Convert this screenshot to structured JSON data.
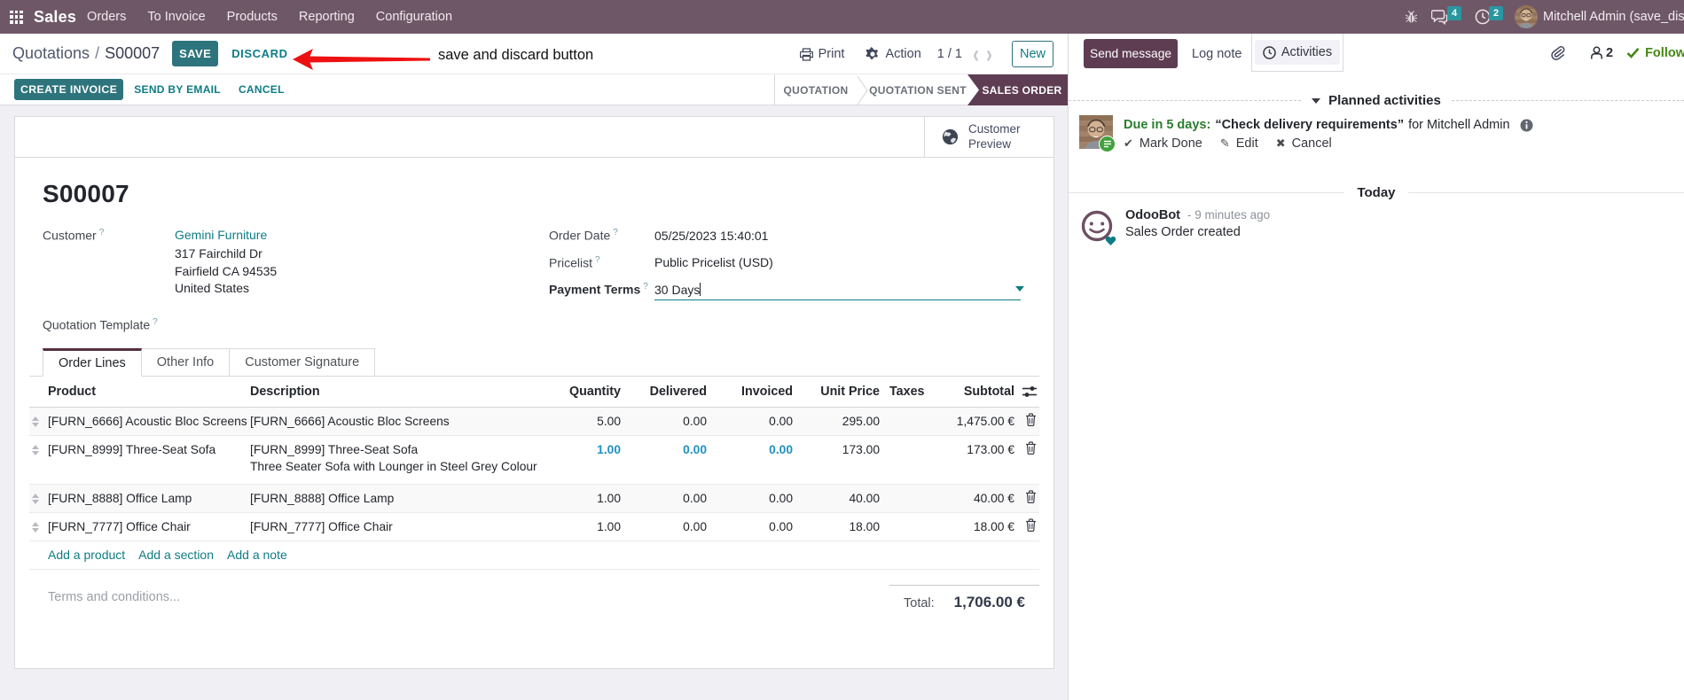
{
  "navbar": {
    "app_name": "Sales",
    "menus": [
      "Orders",
      "To Invoice",
      "Products",
      "Reporting",
      "Configuration"
    ],
    "message_badge": "4",
    "activity_badge": "2",
    "user_name": "Mitchell Admin (save_discard",
    "navbar_color": "#6e5767",
    "badge_color": "#2a97a0"
  },
  "control_panel": {
    "breadcrumb_parent": "Quotations",
    "breadcrumb_sep": "/",
    "breadcrumb_current": "S00007",
    "save_label": "SAVE",
    "discard_label": "DISCARD",
    "annotation_text": "save and discard button",
    "print_label": "Print",
    "action_label": "Action",
    "pager": "1 / 1",
    "prev": "‹",
    "next": "›",
    "new_label": "New"
  },
  "actions": {
    "create_invoice": "CREATE INVOICE",
    "send_by_email": "SEND BY EMAIL",
    "cancel": "CANCEL"
  },
  "statusbar": {
    "stage1": "QUOTATION",
    "stage2": "QUOTATION SENT",
    "stage3": "SALES ORDER",
    "active": "SALES ORDER",
    "active_color": "#5e3d53"
  },
  "sheet": {
    "customer_preview_line1": "Customer",
    "customer_preview_line2": "Preview",
    "title": "S00007",
    "help_mark": "?",
    "fields": {
      "customer_label": "Customer",
      "customer_value": "Gemini Furniture",
      "address_line1": "317 Fairchild Dr",
      "address_line2": "Fairfield CA 94535",
      "address_line3": "United States",
      "quotation_template_label": "Quotation Template",
      "order_date_label": "Order Date",
      "order_date_value": "05/25/2023 15:40:01",
      "pricelist_label": "Pricelist",
      "pricelist_value": "Public Pricelist (USD)",
      "payment_terms_label": "Payment Terms",
      "payment_terms_value": "30 Days"
    },
    "tabs": {
      "tab1": "Order Lines",
      "tab2": "Other Info",
      "tab3": "Customer Signature"
    },
    "table": {
      "headers": {
        "product": "Product",
        "description": "Description",
        "quantity": "Quantity",
        "delivered": "Delivered",
        "invoiced": "Invoiced",
        "unit_price": "Unit Price",
        "taxes": "Taxes",
        "subtotal": "Subtotal"
      },
      "rows": [
        {
          "product": "[FURN_6666] Acoustic Bloc Screens",
          "description": "[FURN_6666] Acoustic Bloc Screens",
          "quantity": "5.00",
          "delivered": "0.00",
          "invoiced": "0.00",
          "unit_price": "295.00",
          "taxes": "",
          "subtotal": "1,475.00 €"
        },
        {
          "product": "[FURN_8999] Three-Seat Sofa",
          "description": "[FURN_8999] Three-Seat Sofa",
          "description2": "Three Seater Sofa with Lounger in Steel Grey Colour",
          "quantity": "1.00",
          "delivered": "0.00",
          "invoiced": "0.00",
          "unit_price": "173.00",
          "taxes": "",
          "subtotal": "173.00 €"
        },
        {
          "product": "[FURN_8888] Office Lamp",
          "description": "[FURN_8888] Office Lamp",
          "quantity": "1.00",
          "delivered": "0.00",
          "invoiced": "0.00",
          "unit_price": "40.00",
          "taxes": "",
          "subtotal": "40.00 €"
        },
        {
          "product": "[FURN_7777] Office Chair",
          "description": "[FURN_7777] Office Chair",
          "quantity": "1.00",
          "delivered": "0.00",
          "invoiced": "0.00",
          "unit_price": "18.00",
          "taxes": "",
          "subtotal": "18.00 €"
        }
      ],
      "add_product": "Add a product",
      "add_section": "Add a section",
      "add_note": "Add a note"
    },
    "terms_placeholder": "Terms and conditions...",
    "total_label": "Total:",
    "total_value": "1,706.00 €"
  },
  "chatter": {
    "send_message": "Send message",
    "log_note": "Log note",
    "activities": "Activities",
    "followers_count": "2",
    "following_label": "Following",
    "planned_header": "Planned activities",
    "activity": {
      "due": "Due in 5 days:",
      "summary": "“Check delivery requirements”",
      "assignee": "for Mitchell Admin",
      "mark_done": "Mark Done",
      "edit": "Edit",
      "cancel": "Cancel",
      "mark_done_icon": "✔",
      "edit_icon": "✎",
      "cancel_icon": "✖"
    },
    "today_label": "Today",
    "message": {
      "author": "OdooBot",
      "time": "- 9 minutes ago",
      "body": "Sales Order created"
    }
  },
  "colors": {
    "primary_teal": "#2e747d",
    "link_teal": "#0e7c85",
    "brand_purple": "#5e3d53",
    "highlight_blue": "#2091c1",
    "success_green": "#448712",
    "annotation_red": "#ee1111",
    "background": "#f0eff4"
  }
}
